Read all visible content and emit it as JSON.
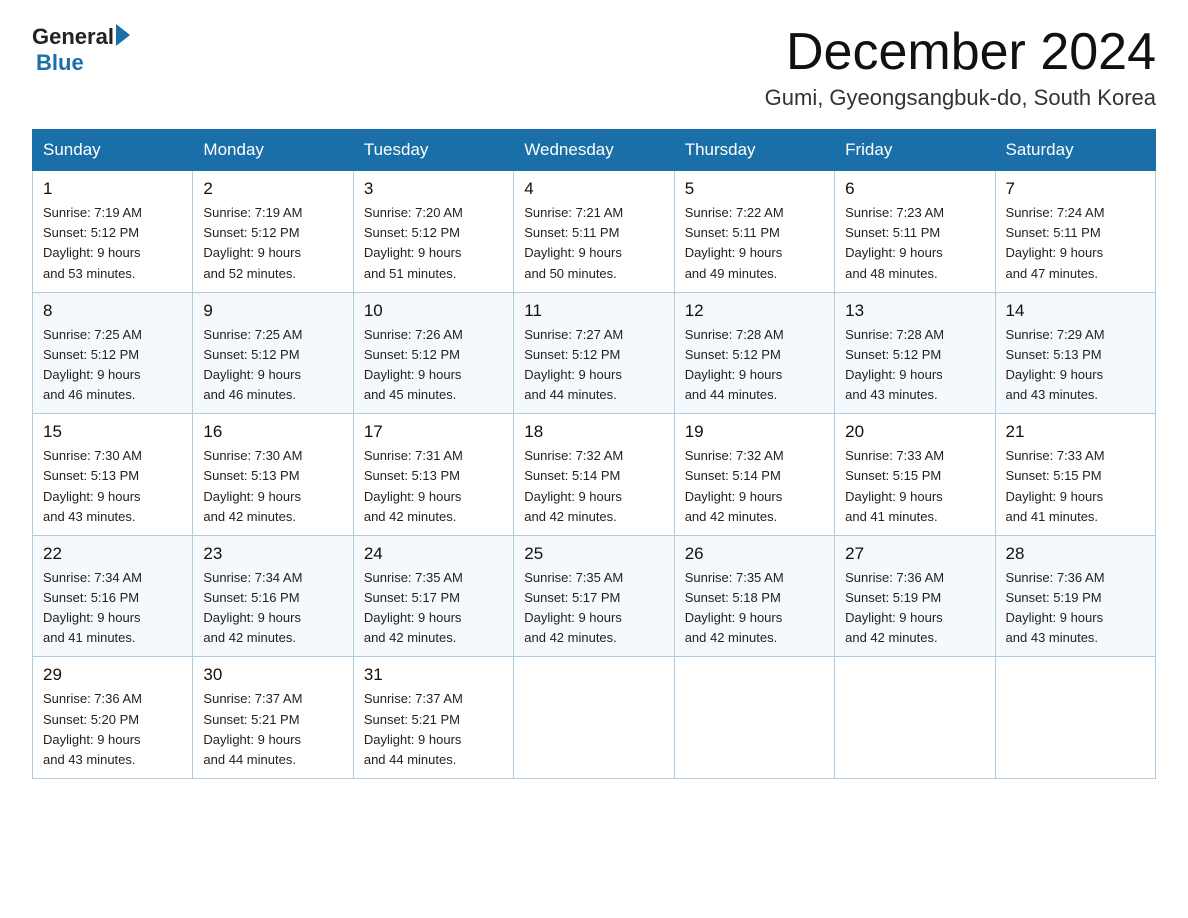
{
  "logo": {
    "text_general": "General",
    "text_blue": "Blue"
  },
  "title": "December 2024",
  "subtitle": "Gumi, Gyeongsangbuk-do, South Korea",
  "days_header": [
    "Sunday",
    "Monday",
    "Tuesday",
    "Wednesday",
    "Thursday",
    "Friday",
    "Saturday"
  ],
  "weeks": [
    [
      {
        "day": "1",
        "sunrise": "7:19 AM",
        "sunset": "5:12 PM",
        "daylight": "9 hours and 53 minutes."
      },
      {
        "day": "2",
        "sunrise": "7:19 AM",
        "sunset": "5:12 PM",
        "daylight": "9 hours and 52 minutes."
      },
      {
        "day": "3",
        "sunrise": "7:20 AM",
        "sunset": "5:12 PM",
        "daylight": "9 hours and 51 minutes."
      },
      {
        "day": "4",
        "sunrise": "7:21 AM",
        "sunset": "5:11 PM",
        "daylight": "9 hours and 50 minutes."
      },
      {
        "day": "5",
        "sunrise": "7:22 AM",
        "sunset": "5:11 PM",
        "daylight": "9 hours and 49 minutes."
      },
      {
        "day": "6",
        "sunrise": "7:23 AM",
        "sunset": "5:11 PM",
        "daylight": "9 hours and 48 minutes."
      },
      {
        "day": "7",
        "sunrise": "7:24 AM",
        "sunset": "5:11 PM",
        "daylight": "9 hours and 47 minutes."
      }
    ],
    [
      {
        "day": "8",
        "sunrise": "7:25 AM",
        "sunset": "5:12 PM",
        "daylight": "9 hours and 46 minutes."
      },
      {
        "day": "9",
        "sunrise": "7:25 AM",
        "sunset": "5:12 PM",
        "daylight": "9 hours and 46 minutes."
      },
      {
        "day": "10",
        "sunrise": "7:26 AM",
        "sunset": "5:12 PM",
        "daylight": "9 hours and 45 minutes."
      },
      {
        "day": "11",
        "sunrise": "7:27 AM",
        "sunset": "5:12 PM",
        "daylight": "9 hours and 44 minutes."
      },
      {
        "day": "12",
        "sunrise": "7:28 AM",
        "sunset": "5:12 PM",
        "daylight": "9 hours and 44 minutes."
      },
      {
        "day": "13",
        "sunrise": "7:28 AM",
        "sunset": "5:12 PM",
        "daylight": "9 hours and 43 minutes."
      },
      {
        "day": "14",
        "sunrise": "7:29 AM",
        "sunset": "5:13 PM",
        "daylight": "9 hours and 43 minutes."
      }
    ],
    [
      {
        "day": "15",
        "sunrise": "7:30 AM",
        "sunset": "5:13 PM",
        "daylight": "9 hours and 43 minutes."
      },
      {
        "day": "16",
        "sunrise": "7:30 AM",
        "sunset": "5:13 PM",
        "daylight": "9 hours and 42 minutes."
      },
      {
        "day": "17",
        "sunrise": "7:31 AM",
        "sunset": "5:13 PM",
        "daylight": "9 hours and 42 minutes."
      },
      {
        "day": "18",
        "sunrise": "7:32 AM",
        "sunset": "5:14 PM",
        "daylight": "9 hours and 42 minutes."
      },
      {
        "day": "19",
        "sunrise": "7:32 AM",
        "sunset": "5:14 PM",
        "daylight": "9 hours and 42 minutes."
      },
      {
        "day": "20",
        "sunrise": "7:33 AM",
        "sunset": "5:15 PM",
        "daylight": "9 hours and 41 minutes."
      },
      {
        "day": "21",
        "sunrise": "7:33 AM",
        "sunset": "5:15 PM",
        "daylight": "9 hours and 41 minutes."
      }
    ],
    [
      {
        "day": "22",
        "sunrise": "7:34 AM",
        "sunset": "5:16 PM",
        "daylight": "9 hours and 41 minutes."
      },
      {
        "day": "23",
        "sunrise": "7:34 AM",
        "sunset": "5:16 PM",
        "daylight": "9 hours and 42 minutes."
      },
      {
        "day": "24",
        "sunrise": "7:35 AM",
        "sunset": "5:17 PM",
        "daylight": "9 hours and 42 minutes."
      },
      {
        "day": "25",
        "sunrise": "7:35 AM",
        "sunset": "5:17 PM",
        "daylight": "9 hours and 42 minutes."
      },
      {
        "day": "26",
        "sunrise": "7:35 AM",
        "sunset": "5:18 PM",
        "daylight": "9 hours and 42 minutes."
      },
      {
        "day": "27",
        "sunrise": "7:36 AM",
        "sunset": "5:19 PM",
        "daylight": "9 hours and 42 minutes."
      },
      {
        "day": "28",
        "sunrise": "7:36 AM",
        "sunset": "5:19 PM",
        "daylight": "9 hours and 43 minutes."
      }
    ],
    [
      {
        "day": "29",
        "sunrise": "7:36 AM",
        "sunset": "5:20 PM",
        "daylight": "9 hours and 43 minutes."
      },
      {
        "day": "30",
        "sunrise": "7:37 AM",
        "sunset": "5:21 PM",
        "daylight": "9 hours and 44 minutes."
      },
      {
        "day": "31",
        "sunrise": "7:37 AM",
        "sunset": "5:21 PM",
        "daylight": "9 hours and 44 minutes."
      },
      null,
      null,
      null,
      null
    ]
  ],
  "labels": {
    "sunrise": "Sunrise:",
    "sunset": "Sunset:",
    "daylight": "Daylight:"
  }
}
